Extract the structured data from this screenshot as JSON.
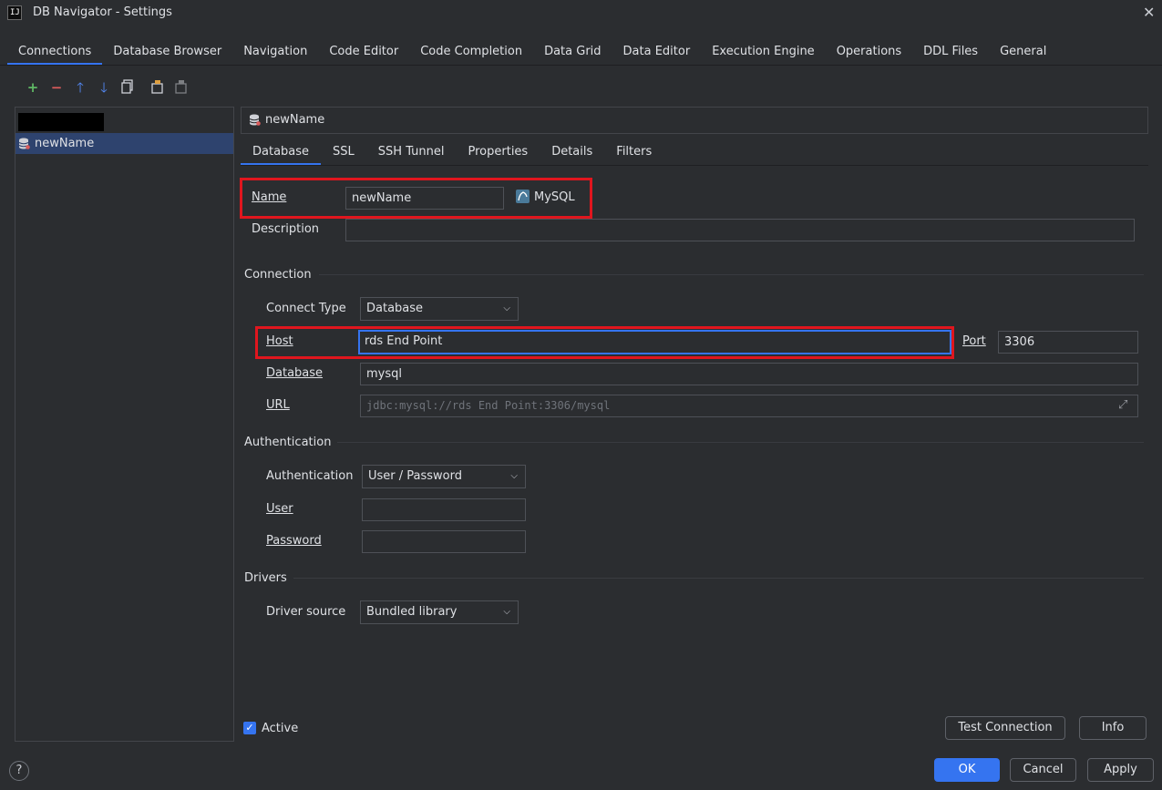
{
  "window": {
    "title": "DB Navigator - Settings",
    "app_icon_text": "IJ"
  },
  "top_tabs": [
    "Connections",
    "Database Browser",
    "Navigation",
    "Code Editor",
    "Code Completion",
    "Data Grid",
    "Data Editor",
    "Execution Engine",
    "Operations",
    "DDL Files",
    "General"
  ],
  "toolbar": {
    "icons": [
      "add-icon",
      "remove-icon",
      "move-up-icon",
      "move-down-icon",
      "copy-icon",
      "export-icon",
      "import-icon"
    ]
  },
  "tree": {
    "selected": "newName"
  },
  "connection_header": "newName",
  "sub_tabs": [
    "Database",
    "SSL",
    "SSH Tunnel",
    "Properties",
    "Details",
    "Filters"
  ],
  "form": {
    "name_label": "Name",
    "name_value": "newName",
    "db_type": "MySQL",
    "description_label": "Description",
    "description_value": "",
    "connection_section": "Connection",
    "connect_type_label": "Connect Type",
    "connect_type_value": "Database",
    "host_label": "Host",
    "host_value": "rds End Point",
    "port_label": "Port",
    "port_value": "3306",
    "database_label": "Database",
    "database_value": "mysql",
    "url_label": "URL",
    "url_value": "jdbc:mysql://rds End Point:3306/mysql",
    "authentication_section": "Authentication",
    "authentication_label": "Authentication",
    "authentication_value": "User / Password",
    "user_label": "User",
    "user_value": "",
    "password_label": "Password",
    "password_value": "",
    "drivers_section": "Drivers",
    "driver_source_label": "Driver source",
    "driver_source_value": "Bundled library",
    "active_label": "Active",
    "active_checked": true
  },
  "buttons": {
    "test_connection": "Test Connection",
    "info": "Info",
    "ok": "OK",
    "cancel": "Cancel",
    "apply": "Apply",
    "help": "?"
  },
  "colors": {
    "accent": "#3574f0",
    "highlight_red": "#e0161e",
    "background": "#2b2d30"
  }
}
